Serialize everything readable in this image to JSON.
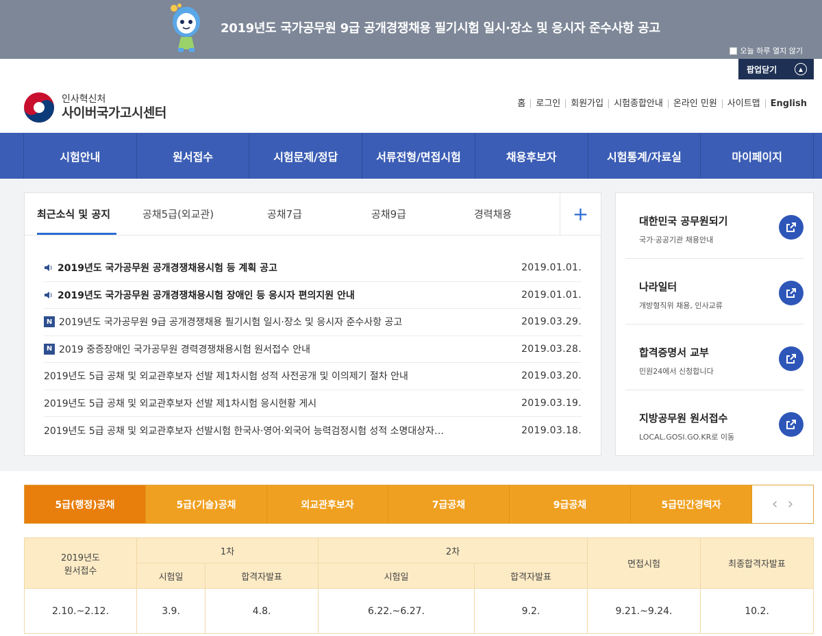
{
  "popup": {
    "title": "2019년도 국가공무원 9급 공개경쟁채용 필기시험 일시·장소 및 응시자 준수사항 공고",
    "dont_open_today": "오늘 하루 열지 않기",
    "close_label": "팝업닫기"
  },
  "header": {
    "org": "인사혁신처",
    "site": "사이버국가고시센터",
    "util": [
      "홈",
      "로그인",
      "회원가입",
      "시험종합안내",
      "온라인 민원",
      "사이트맵",
      "English"
    ]
  },
  "gnb": [
    "시험안내",
    "원서접수",
    "시험문제/정답",
    "서류전형/면접시험",
    "채용후보자",
    "시험통계/자료실",
    "마이페이지"
  ],
  "notice": {
    "tabs": [
      "최근소식 및 공지",
      "공채5급(외교관)",
      "공채7급",
      "공채9급",
      "경력채용"
    ],
    "items": [
      {
        "title": "2019년도 국가공무원 공개경쟁채용시험 등 계획 공고",
        "date": "2019.01.01.",
        "type": "speaker"
      },
      {
        "title": "2019년도 국가공무원 공개경쟁채용시험 장애인 등 응시자 편의지원 안내",
        "date": "2019.01.01.",
        "type": "speaker"
      },
      {
        "title": "2019년도 국가공무원 9급 공개경쟁채용 필기시험 일시·장소 및 응시자 준수사항 공고",
        "date": "2019.03.29.",
        "type": "new"
      },
      {
        "title": "2019 중증장애인 국가공무원 경력경쟁채용시험 원서접수 안내",
        "date": "2019.03.28.",
        "type": "new"
      },
      {
        "title": "2019년도 5급 공채 및 외교관후보자 선발 제1차시험 성적 사전공개 및 이의제기 절차 안내",
        "date": "2019.03.20.",
        "type": "plain"
      },
      {
        "title": "2019년도 5급 공채 및 외교관후보자 선발 제1차시험 응시현황 게시",
        "date": "2019.03.19.",
        "type": "plain"
      },
      {
        "title": "2019년도 5급 공채 및 외교관후보자 선발시험 한국사·영어·외국어 능력검정시험 성적 소명대상자…",
        "date": "2019.03.18.",
        "type": "plain"
      }
    ],
    "new_badge": "N"
  },
  "quick_links": [
    {
      "title": "대한민국 공무원되기",
      "sub": "국가·공공기관 채용안내"
    },
    {
      "title": "나라일터",
      "sub": "개방형직위 채용, 인사교류"
    },
    {
      "title": "합격증명서 교부",
      "sub": "민원24에서 신청합니다"
    },
    {
      "title": "지방공무원 원서접수",
      "sub": "LOCAL.GOSI.GO.KR로 이동"
    }
  ],
  "exam_tabs": [
    "5급(행정)공채",
    "5급(기술)공채",
    "외교관후보자",
    "7급공채",
    "9급공채",
    "5급민간경력자"
  ],
  "schedule": {
    "col_year": "2019년도\n원서접수",
    "first": "1차",
    "second": "2차",
    "exam_day": "시험일",
    "pass_announce": "합격자발표",
    "interview": "면접시험",
    "final": "최종합격자발표",
    "values": [
      "2.10.~2.12.",
      "3.9.",
      "4.8.",
      "6.22.~6.27.",
      "9.2.",
      "9.21.~9.24.",
      "10.2."
    ]
  },
  "colors": {
    "gnb": "#3b5db5",
    "accent_blue": "#2d6bd2",
    "orange": "#f0a020",
    "orange_active": "#e87e0c"
  }
}
